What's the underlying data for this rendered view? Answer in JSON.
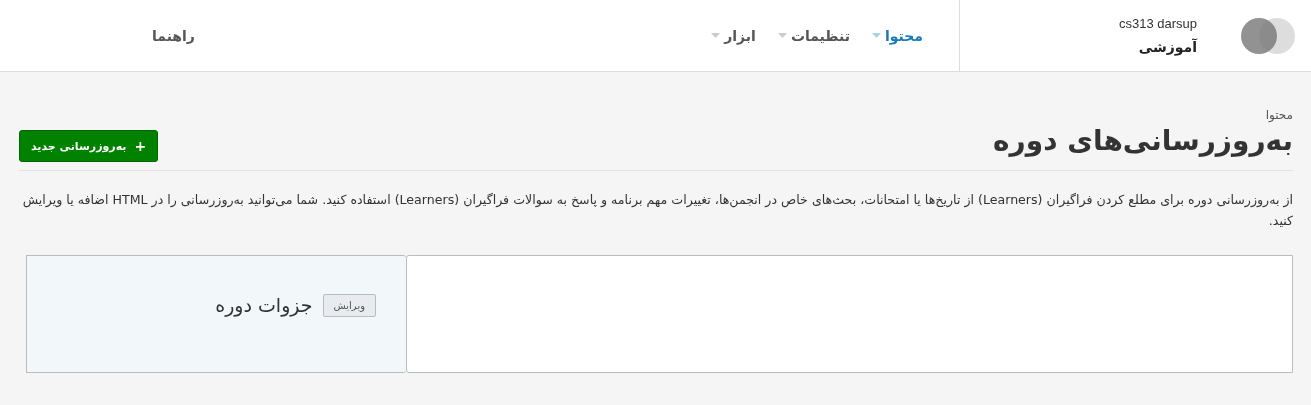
{
  "header": {
    "org": "cs313 darsup",
    "course": "آموزشی"
  },
  "nav": [
    {
      "label": "محتوا",
      "selected": true,
      "dropdown": true
    },
    {
      "label": "تنظیمات",
      "selected": false,
      "dropdown": true
    },
    {
      "label": "ابزار",
      "selected": false,
      "dropdown": true
    }
  ],
  "help_link": "راهنما",
  "breadcrumb": "محتوا",
  "title": "به‌روزرسانی‌های دوره",
  "new_button": {
    "icon": "+",
    "label": "به‌روزرسانی جدید"
  },
  "description": "از به‌روزرسانی دوره برای مطلع کردن فراگیران (Learners) از تاریخ‌ها یا امتحانات، بحث‌های خاص در انجمن‌ها، تغییرات مهم برنامه و پاسخ به سوالات فراگیران (Learners) استفاده کنید. شما می‌توانید به‌روزرسانی را در HTML اضافه یا ویرایش کنید.",
  "handouts": {
    "title": "جزوات دوره",
    "edit_button": "ویرایش"
  }
}
